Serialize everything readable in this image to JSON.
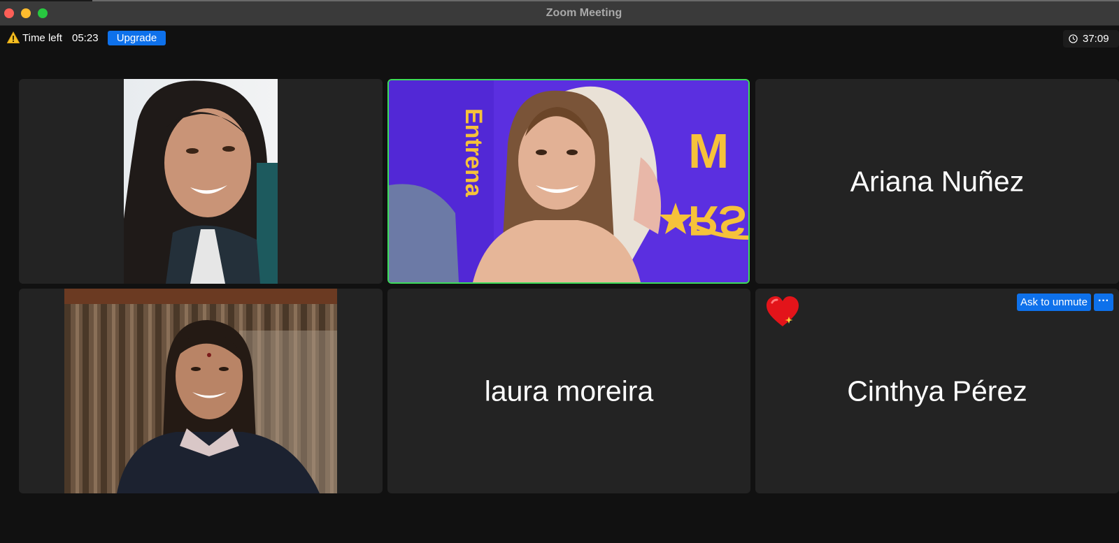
{
  "window": {
    "title": "Zoom Meeting"
  },
  "infobar": {
    "time_left_label": "Time left",
    "time_left_value": "05:23",
    "upgrade_label": "Upgrade",
    "elapsed_time": "37:09",
    "warning_icon": "warning-icon",
    "clock_icon": "clock-icon"
  },
  "participants": [
    {
      "name": "",
      "video": true,
      "active_speaker": false
    },
    {
      "name": "",
      "video": true,
      "active_speaker": true,
      "background_text_1": "M",
      "background_text_2": "RS",
      "background_text_3": "Entrena"
    },
    {
      "name": "Ariana Nuñez",
      "video": false,
      "active_speaker": false
    },
    {
      "name": "",
      "video": true,
      "active_speaker": false
    },
    {
      "name": "laura moreira",
      "video": false,
      "active_speaker": false
    },
    {
      "name": "Cinthya Pérez",
      "video": false,
      "active_speaker": false,
      "reaction": "heart-icon",
      "ask_unmute_label": "Ask to unmute",
      "more_label": "···"
    }
  ],
  "colors": {
    "accent": "#0e71eb",
    "active_speaker_border": "#3ddc5a",
    "tile_background": "#232323",
    "window_background": "#111111"
  }
}
